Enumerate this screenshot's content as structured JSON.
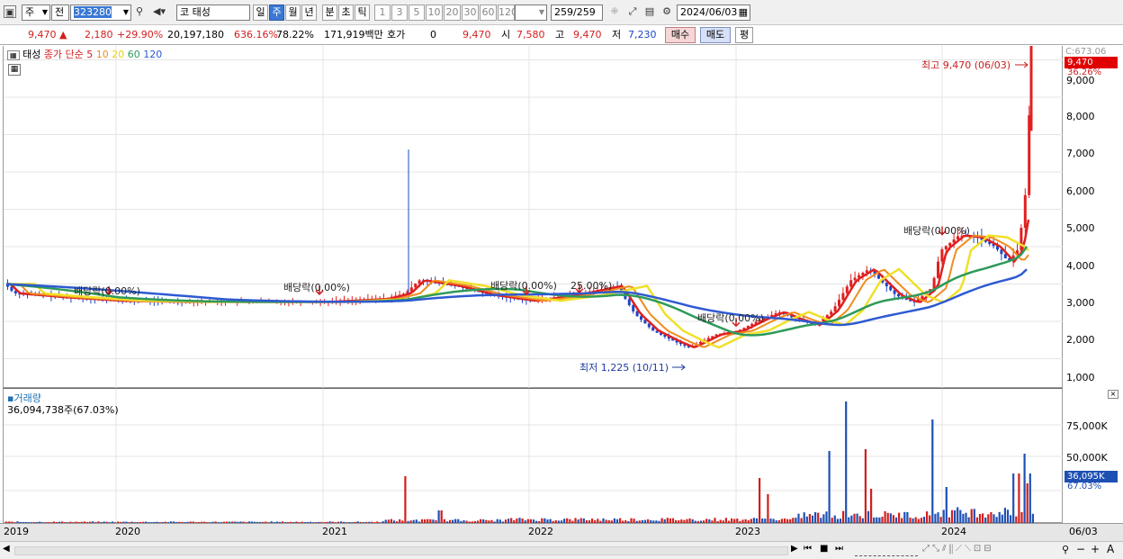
{
  "toolbar": {
    "market": "주",
    "jeon": "전",
    "code": "323280",
    "name_prefix": "코",
    "name": "태성",
    "periods": [
      "일",
      "주",
      "월",
      "년",
      "분",
      "초",
      "틱"
    ],
    "selected_period": "주",
    "intervals": [
      "1",
      "3",
      "5",
      "10",
      "20",
      "30",
      "60",
      "120"
    ],
    "count": "259",
    "count_total": "/259",
    "date": "2024/06/03"
  },
  "quote": {
    "price": "9,470",
    "change": "2,180",
    "change_pct": "+29.90%",
    "volume": "20,197,180",
    "vol_ratio": "636.16%",
    "turnover": "78.22%",
    "amount": "171,919백만",
    "hoga_label": "호가",
    "hoga_value": "0",
    "hoga_price": "9,470",
    "open_label": "시",
    "open": "7,580",
    "high_label": "고",
    "high": "9,470",
    "low_label": "저",
    "low": "7,230",
    "buy_label": "매수",
    "sell_label": "매도",
    "eval_label": "평"
  },
  "price_panel": {
    "name": "태성",
    "ma_label": "종가 단순 5",
    "ma_periods": [
      "10",
      "20",
      "60",
      "120"
    ],
    "ma_colors": {
      "5": "#e02020",
      "10": "#f08c1e",
      "20": "#f0e028",
      "60": "#2e9a5a",
      "120": "#2e5ad2"
    },
    "y_ticks": [
      "9,000",
      "8,000",
      "7,000",
      "6,000",
      "5,000",
      "4,000",
      "3,000",
      "2,000",
      "1,000"
    ],
    "y_top_label": "C:673.06",
    "price_tag": "9,470",
    "pct_tag": "36.26%",
    "max_note": "최고 9,470 (06/03)",
    "min_note": "최저 1,225 (10/11)",
    "dividend_notes": [
      "배당락(0.00%)",
      "배당락(0.00%)",
      "배당락(0.00%)",
      "25.00%)",
      "배당락(0.00%)",
      "배당락(0.00%)"
    ]
  },
  "volume_panel": {
    "title": "거래량",
    "value": "36,094,738주(67.03%)",
    "y_ticks": [
      "75,000K",
      "50,000K"
    ],
    "tag": "36,095K",
    "pct_tag": "67.03%"
  },
  "x_axis": {
    "labels": [
      "2019",
      "2020",
      "2021",
      "2022",
      "2023",
      "2024"
    ],
    "right_label": "06/03"
  }
}
